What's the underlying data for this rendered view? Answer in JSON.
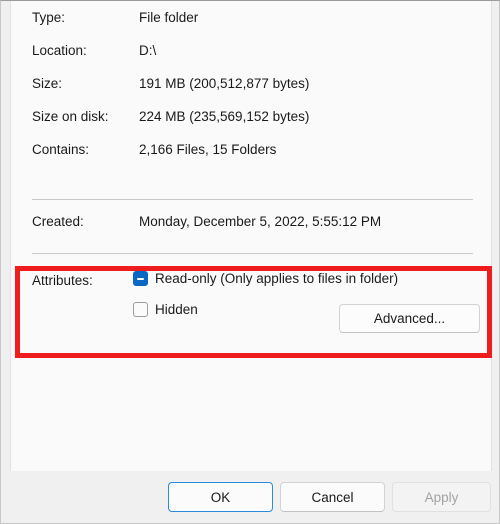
{
  "dialog": {
    "name": "folder-properties-general-tab"
  },
  "properties": [
    {
      "label": "Type:",
      "value": "File folder"
    },
    {
      "label": "Location:",
      "value": "D:\\"
    },
    {
      "label": "Size:",
      "value": "191 MB (200,512,877 bytes)"
    },
    {
      "label": "Size on disk:",
      "value": "224 MB (235,569,152 bytes)"
    },
    {
      "label": "Contains:",
      "value": "2,166 Files, 15 Folders"
    }
  ],
  "created": {
    "label": "Created:",
    "value": "Monday, December 5, 2022, 5:55:12 PM"
  },
  "attributes": {
    "label": "Attributes:",
    "readonly": {
      "label": "Read-only (Only applies to files in folder)",
      "state": "indeterminate"
    },
    "hidden": {
      "label": "Hidden",
      "state": "unchecked"
    },
    "advanced_button": "Advanced..."
  },
  "footer": {
    "ok": "OK",
    "cancel": "Cancel",
    "apply": "Apply"
  },
  "annotation": {
    "color": "#ee1c1c",
    "target": "attributes-section"
  },
  "colors": {
    "accent": "#0a68c4",
    "focus_border": "#2a8ae0",
    "panel_background": "#fafafa",
    "footer_background": "#f0f0f0",
    "disabled_text": "#a2a2a2"
  }
}
